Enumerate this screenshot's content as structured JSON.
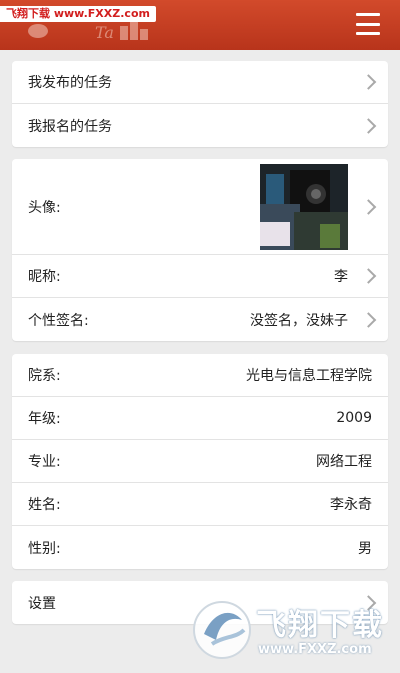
{
  "header": {
    "watermark_text": "飞翔下载 www.FXXZ.com"
  },
  "tasks": {
    "published": "我发布的任务",
    "signed_up": "我报名的任务"
  },
  "profile": {
    "avatar_label": "头像:",
    "nickname_label": "昵称:",
    "nickname_value": "李",
    "signature_label": "个性签名:",
    "signature_value": "没签名，没妹子"
  },
  "info": {
    "department_label": "院系:",
    "department_value": "光电与信息工程学院",
    "grade_label": "年级:",
    "grade_value": "2009",
    "major_label": "专业:",
    "major_value": "网络工程",
    "name_label": "姓名:",
    "name_value": "李永奇",
    "gender_label": "性别:",
    "gender_value": "男"
  },
  "settings": {
    "label": "设置"
  },
  "footer_watermark": {
    "brand": "飞翔下载",
    "url": "www.FXXZ.com"
  },
  "colors": {
    "header": "#c43c22",
    "background": "#ececec"
  }
}
